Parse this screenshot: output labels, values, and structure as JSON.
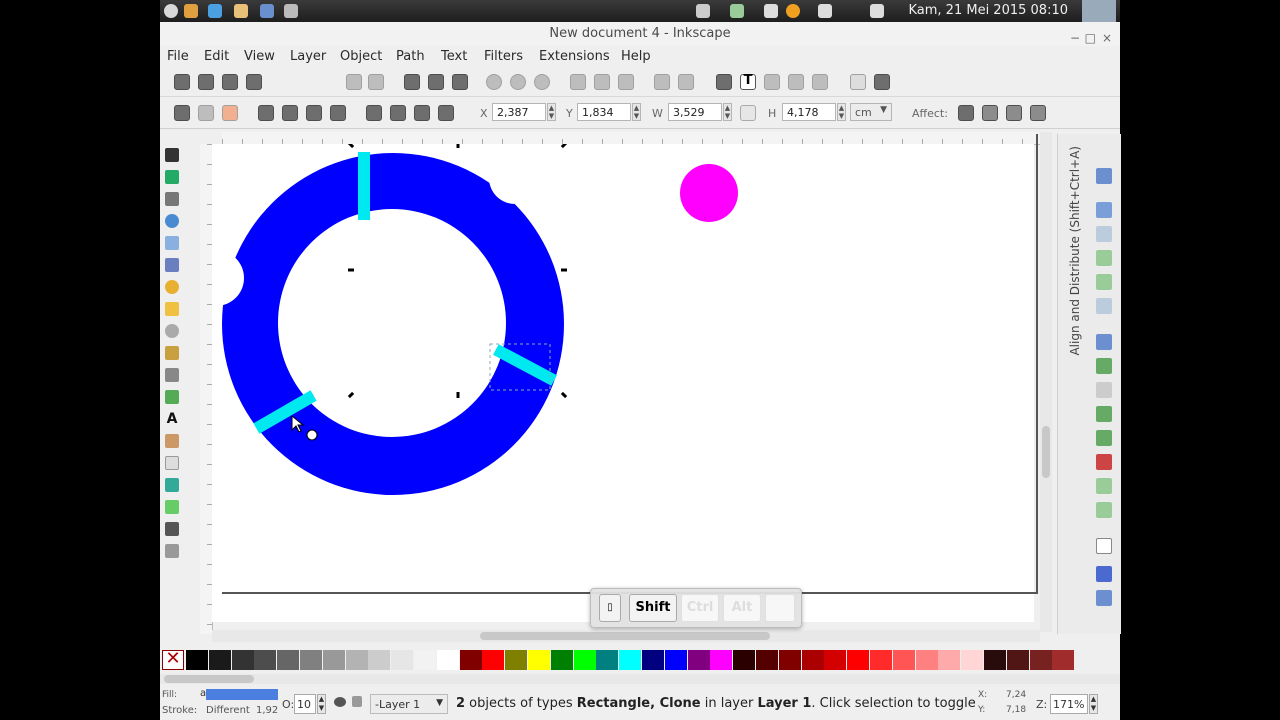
{
  "system_bar": {
    "clock": "Kam, 21 Mei 2015 08:10"
  },
  "window": {
    "title": "New document 4 - Inkscape",
    "minimize": "−",
    "maximize": "□",
    "close": "×"
  },
  "menu": [
    "File",
    "Edit",
    "View",
    "Layer",
    "Object",
    "Path",
    "Text",
    "Filters",
    "Extensions",
    "Help"
  ],
  "toolbar": {
    "x_label": "X",
    "x_value": "2,387",
    "y_label": "Y",
    "y_value": "1,834",
    "w_label": "W",
    "w_value": "3,529",
    "h_label": "H",
    "h_value": "4,178",
    "unit": "cm",
    "affect_label": "Affect:"
  },
  "dock": {
    "title": "Align and Distribute (Shift+Ctrl+A)"
  },
  "keys": {
    "shift": "Shift",
    "ctrl": "Ctrl",
    "alt": "Alt"
  },
  "status": {
    "fill_label": "Fill:",
    "fill_value": "a",
    "stroke_label": "Stroke:",
    "stroke_value": "Different",
    "stroke_width": "1,92",
    "opacity_label": "O:",
    "opacity_value": "10",
    "layer": "-Layer 1",
    "msg_count": "2",
    "msg_a": " objects of types ",
    "msg_types": "Rectangle, Clone",
    "msg_b": " in layer ",
    "msg_layer": "Layer 1",
    "msg_c": ". Click selection to toggle sc...",
    "x_label": "X:",
    "x_value": "7,24",
    "y_label": "Y:",
    "y_value": "7,18",
    "zoom_label": "Z:",
    "zoom_value": "171%"
  },
  "colors": {
    "ring": "#0000ff",
    "bars": "#00e8f0",
    "circle": "#ff00ff"
  },
  "palette": [
    "#000000",
    "#1a1a1a",
    "#333333",
    "#4d4d4d",
    "#666666",
    "#808080",
    "#999999",
    "#b3b3b3",
    "#cccccc",
    "#e6e6e6",
    "#f2f2f2",
    "#ffffff",
    "#800000",
    "#ff0000",
    "#808000",
    "#ffff00",
    "#008000",
    "#00ff00",
    "#008080",
    "#00ffff",
    "#000080",
    "#0000ff",
    "#800080",
    "#ff00ff",
    "#2b0000",
    "#550000",
    "#800000",
    "#aa0000",
    "#d40000",
    "#ff0000",
    "#ff2a2a",
    "#ff5555",
    "#ff8080",
    "#ffaaaa",
    "#ffd5d5",
    "#280b0b",
    "#501616",
    "#782121",
    "#a02c2c"
  ]
}
